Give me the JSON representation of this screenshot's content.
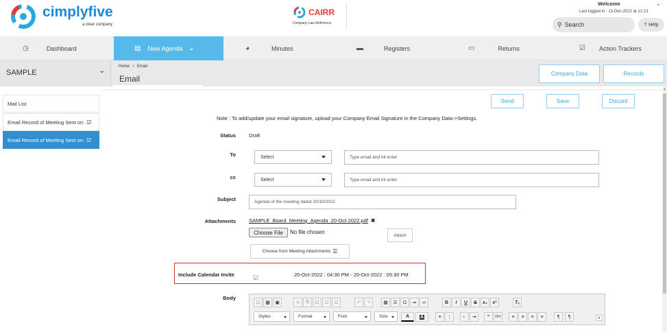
{
  "header": {
    "logo_text": "cimplyfive",
    "logo_tagline": "a clear company",
    "cairr_text": "CAIRR",
    "cairr_tagline": "Company Law Reference",
    "welcome": "Welcome",
    "last_logged": "Last logged in : 13-Dec-2022 at 12:13",
    "search_placeholder": "Search",
    "help_label": "Help"
  },
  "nav": {
    "items": [
      {
        "label": "Dashboard",
        "icon": "dashboard-icon"
      },
      {
        "label": "New Agenda",
        "icon": "agenda-icon",
        "active": true
      },
      {
        "label": "Minutes",
        "icon": "clock-icon"
      },
      {
        "label": "Registers",
        "icon": "folder-icon"
      },
      {
        "label": "Returns",
        "icon": "document-icon"
      },
      {
        "label": "Action Trackers",
        "icon": "checklist-icon"
      }
    ]
  },
  "subbar": {
    "company": "SAMPLE",
    "breadcrumb_home": "Home",
    "breadcrumb_sep": "/",
    "breadcrumb_current": "Email",
    "page_title": "Email",
    "company_data_btn": "Company Data",
    "records_btn": "Records"
  },
  "sidebar": {
    "items": [
      {
        "label": "Mail List"
      },
      {
        "label": "Email Record of Meeting Sent on:"
      },
      {
        "label": "Email Record of Meeting Sent on:",
        "active": true
      }
    ]
  },
  "actions": {
    "send": "Send",
    "save": "Save",
    "discard": "Discard"
  },
  "form": {
    "note": "Note : To add/update your email signature, upload your Company Email Signature in the Company Data->Settings.",
    "status_label": "Status",
    "status_value": "Draft",
    "to_label": "To",
    "to_select": "Select",
    "to_placeholder": "Type email and hit enter",
    "cc_label": "cc",
    "cc_select": "Select",
    "cc_placeholder": "Type email and hit enter",
    "subject_label": "Subject",
    "subject_value": "Agenda of the meeting dated 20/10/2022",
    "attachments_label": "Attachments",
    "attachment_file": "SAMPLE_Board_Meeting_Agenda_20-Oct-2022.pdf",
    "choose_file": "Choose File",
    "no_file": "No file chosen",
    "attach_btn": "Attach",
    "choose_meeting_btn": "Choose from Meeting Attachments",
    "calendar_label": "Include Calendar Invite",
    "calendar_value": "20-Oct-2022 : 04:30 PM - 20-Oct-2022 : 05:30 PM",
    "body_label": "Body"
  },
  "editor": {
    "styles": "Styles",
    "format": "Format",
    "font": "Font",
    "size": "Size",
    "text_color": "A",
    "bg_color": "A"
  },
  "colors": {
    "accent": "#55b9ea",
    "brand_red": "#e53935",
    "brand_blue": "#1e88e5",
    "highlight_border": "#d32f2f"
  }
}
